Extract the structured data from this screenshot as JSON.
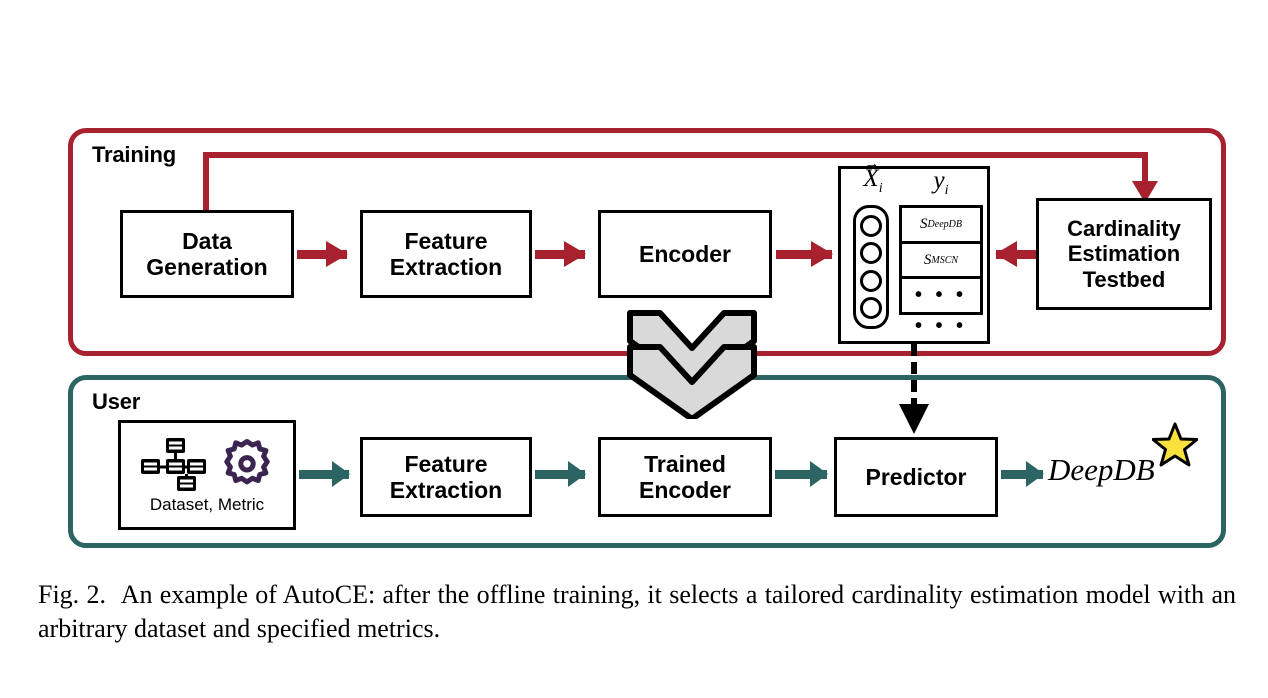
{
  "figure": {
    "caption_prefix": "Fig. 2.",
    "caption_text": "An example of AutoCE: after the offline training, it selects a tailored cardinality estimation model with an arbitrary dataset and specified metrics."
  },
  "colors": {
    "training_accent": "#A8212F",
    "user_accent": "#2B6462",
    "gear": "#3B2450",
    "star": "#F9E03D",
    "box_border": "#000000",
    "background": "#FFFFFF"
  },
  "training": {
    "label": "Training",
    "boxes": [
      {
        "id": "data-generation",
        "line1": "Data",
        "line2": "Generation"
      },
      {
        "id": "feature-extraction",
        "line1": "Feature",
        "line2": "Extraction"
      },
      {
        "id": "encoder",
        "line1": "Encoder",
        "line2": ""
      },
      {
        "id": "cardinality-estimation-testbed",
        "line1": "Cardinality",
        "line2": "Estimation",
        "line3": "Testbed"
      }
    ],
    "vector": {
      "x_label": "X⃗i",
      "x_label_base": "X",
      "x_label_sub": "i",
      "y_label": "y",
      "y_label_sub": "i",
      "circles": 4,
      "cells": [
        {
          "symbol": "S",
          "sub": "DeepDB"
        },
        {
          "symbol": "S",
          "sub": "MSCN"
        }
      ],
      "inner_dots": "• • •",
      "outer_dots": "• • •"
    }
  },
  "user": {
    "label": "User",
    "input_box": {
      "caption": "Dataset, Metric",
      "icons": [
        "database-network-icon",
        "gear-icon"
      ]
    },
    "boxes": [
      {
        "id": "feature-extraction",
        "line1": "Feature",
        "line2": "Extraction"
      },
      {
        "id": "trained-encoder",
        "line1": "Trained",
        "line2": "Encoder"
      },
      {
        "id": "predictor",
        "line1": "Predictor",
        "line2": ""
      }
    ],
    "result": {
      "label": "DeepDB",
      "badge": "star-icon"
    }
  },
  "connectors": {
    "feedback_arrow": "data-generation-to-cardinality-testbed",
    "chevron_count": 2,
    "dashed_arrow": "vector-to-predictor"
  }
}
